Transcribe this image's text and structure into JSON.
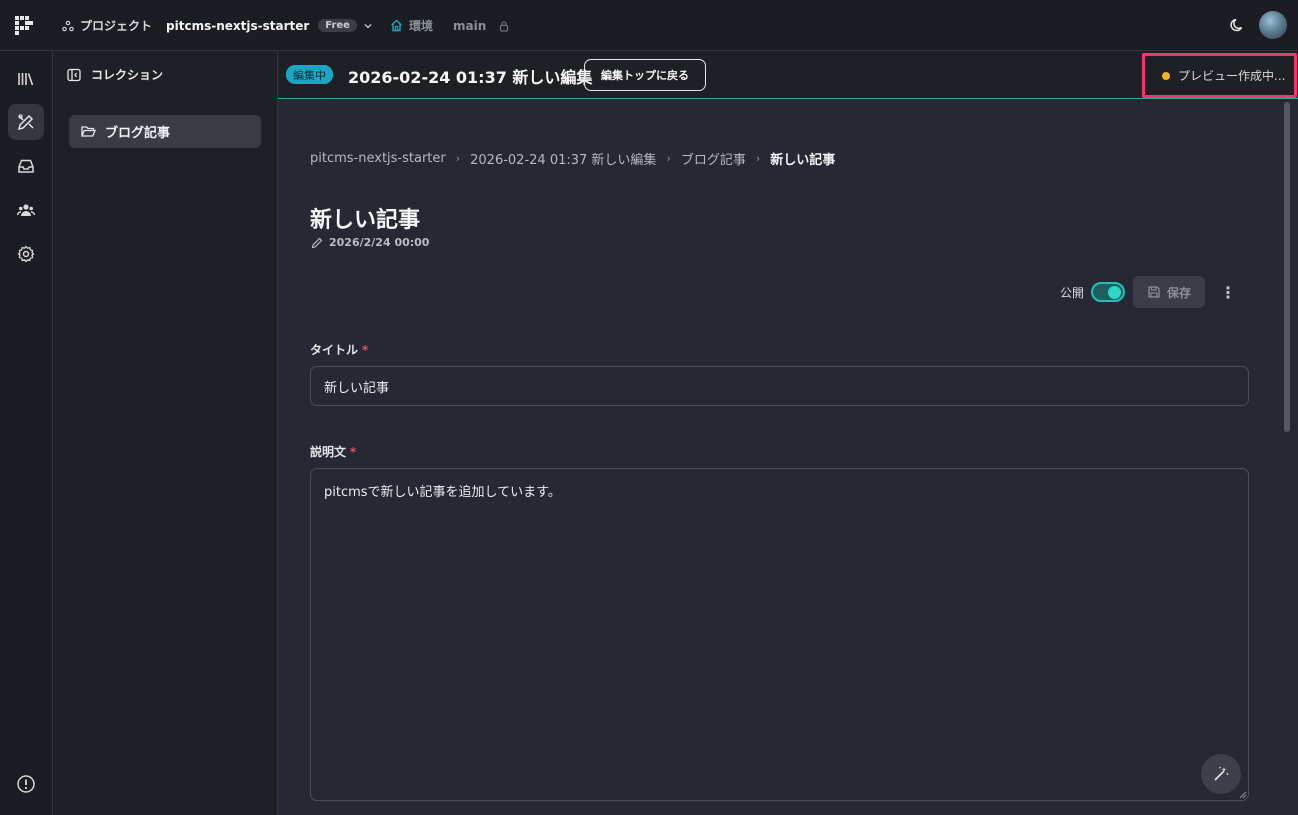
{
  "topbar": {
    "project_label": "プロジェクト",
    "project_name": "pitcms-nextjs-starter",
    "plan_badge": "Free",
    "env_label": "環境",
    "env_value": "main",
    "icons": [
      "logo-icon",
      "project-icon",
      "chevron-down-icon",
      "environment-icon",
      "lock-icon",
      "moon-icon"
    ]
  },
  "rail": {
    "icons": [
      "library-icon",
      "edit-icon",
      "inbox-icon",
      "users-icon",
      "settings-icon",
      "alert-icon"
    ],
    "active": "edit-icon"
  },
  "sidebar": {
    "header": "コレクション",
    "items": [
      {
        "label": "ブログ記事"
      }
    ]
  },
  "edit_header": {
    "status_tag": "編集中",
    "title": "2026-02-24 01:37 新しい編集",
    "back_button": "編集トップに戻る",
    "preview_status": "プレビュー作成中..."
  },
  "breadcrumb": [
    "pitcms-nextjs-starter",
    "2026-02-24 01:37 新しい編集",
    "ブログ記事",
    "新しい記事"
  ],
  "page": {
    "title": "新しい記事",
    "date": "2026/2/24 00:00"
  },
  "actions": {
    "publish_label": "公開",
    "publish_on": true,
    "save_label": "保存"
  },
  "form": {
    "title_label": "タイトル",
    "title_required": "*",
    "title_value": "新しい記事",
    "desc_label": "説明文",
    "desc_required": "*",
    "desc_value": "pitcmsで新しい記事を追加しています。"
  },
  "colors": {
    "accent": "#1aa7c4",
    "toggle": "#2fd6c6",
    "highlight": "#f0386f",
    "status_dot": "#f1b41e"
  }
}
